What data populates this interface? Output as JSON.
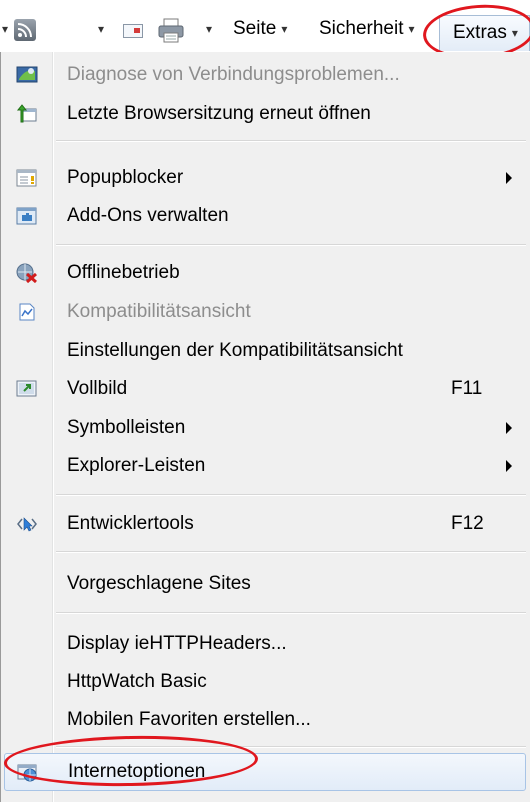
{
  "toolbar": {
    "page_label": "Seite",
    "safety_label": "Sicherheit",
    "tools_label": "Extras",
    "caret": "▾"
  },
  "menu": {
    "items": [
      {
        "label": "Diagnose von Verbindungsproblemen...",
        "disabled": true,
        "icon": "network-diagnose-icon"
      },
      {
        "label": "Letzte Browsersitzung erneut öffnen",
        "icon": "reopen-session-icon"
      },
      {
        "label": "Popupblocker",
        "submenu": true,
        "icon": "popup-blocker-icon"
      },
      {
        "label": "Add-Ons verwalten",
        "icon": "addons-icon"
      },
      {
        "label": "Offlinebetrieb",
        "icon": "offline-icon"
      },
      {
        "label": "Kompatibilitätsansicht",
        "disabled": true,
        "icon": "compatibility-icon"
      },
      {
        "label": "Einstellungen der Kompatibilitätsansicht"
      },
      {
        "label": "Vollbild",
        "shortcut": "F11",
        "icon": "fullscreen-icon"
      },
      {
        "label": "Symbolleisten",
        "submenu": true
      },
      {
        "label": "Explorer-Leisten",
        "submenu": true
      },
      {
        "label": "Entwicklertools",
        "shortcut": "F12",
        "icon": "developer-tools-icon"
      },
      {
        "label": "Vorgeschlagene Sites"
      },
      {
        "label": "Display ieHTTPHeaders..."
      },
      {
        "label": "HttpWatch Basic"
      },
      {
        "label": "Mobilen Favoriten erstellen..."
      },
      {
        "label": "Internetoptionen",
        "highlighted": true,
        "icon": "internet-options-icon"
      }
    ]
  },
  "colors": {
    "highlight_ring": "#e0171e",
    "disabled_text": "#8d8d8d",
    "menu_background": "#f0f0f0"
  }
}
